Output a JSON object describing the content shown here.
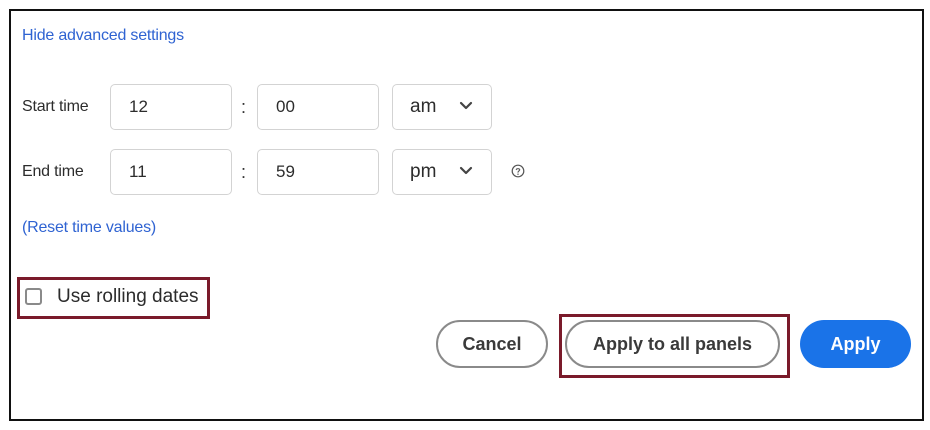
{
  "advanced": {
    "hide_link": "Hide advanced settings",
    "reset_link": "(Reset time values)"
  },
  "start_time": {
    "label": "Start time",
    "hour": "12",
    "minute": "00",
    "separator": ":",
    "period": "am"
  },
  "end_time": {
    "label": "End time",
    "hour": "11",
    "minute": "59",
    "separator": ":",
    "period": "pm"
  },
  "rolling_dates": {
    "label": "Use rolling dates",
    "checked": false
  },
  "buttons": {
    "cancel": "Cancel",
    "apply_all": "Apply to all panels",
    "apply": "Apply"
  },
  "colors": {
    "link": "#2f63d2",
    "primary": "#1a73e8",
    "highlight": "#7a1a2a"
  },
  "icons": {
    "chevron": "chevron-down-icon",
    "info": "help-circle-icon"
  }
}
